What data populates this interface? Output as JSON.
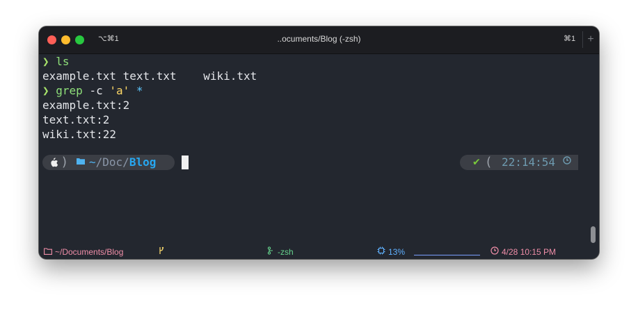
{
  "window": {
    "title": "..ocuments/Blog (-zsh)",
    "tab_shortcut_left": "⌥⌘1",
    "tab_shortcut_right": "⌘1",
    "new_tab_symbol": "+"
  },
  "terminal": {
    "prompt_symbol": "❯",
    "lines": [
      {
        "type": "command",
        "cmd": "ls",
        "args": ""
      },
      {
        "type": "output",
        "text": "example.txt text.txt    wiki.txt"
      },
      {
        "type": "command",
        "cmd": "grep",
        "flag": "-c",
        "str": "'a'",
        "glob": "*"
      },
      {
        "type": "output",
        "text": "example.txt:2"
      },
      {
        "type": "output",
        "text": "text.txt:2"
      },
      {
        "type": "output",
        "text": "wiki.txt:22"
      }
    ]
  },
  "prompt": {
    "os_icon": "apple-icon",
    "folder_icon": "folder-icon",
    "path_tilde": "~",
    "path_middle": "/Doc/",
    "path_last": "Blog",
    "status_icon": "check-icon",
    "status_mark": "✔",
    "time": "22:14:54",
    "clock_icon": "clock-icon"
  },
  "statusbar": {
    "path": "~/Documents/Blog",
    "branch_icon": "git-branch-icon",
    "job_icon": "process-icon",
    "job": "-zsh",
    "cpu_icon": "cpu-icon",
    "cpu": "13%",
    "clock_icon": "clock-icon",
    "datetime": "4/28 10:15 PM"
  },
  "colors": {
    "background": "#23272f",
    "prompt_arrow": "#a7e36b",
    "command": "#8fe07a",
    "string": "#ffd866",
    "glob": "#5ec8ff",
    "path_accent": "#27a7f0"
  }
}
